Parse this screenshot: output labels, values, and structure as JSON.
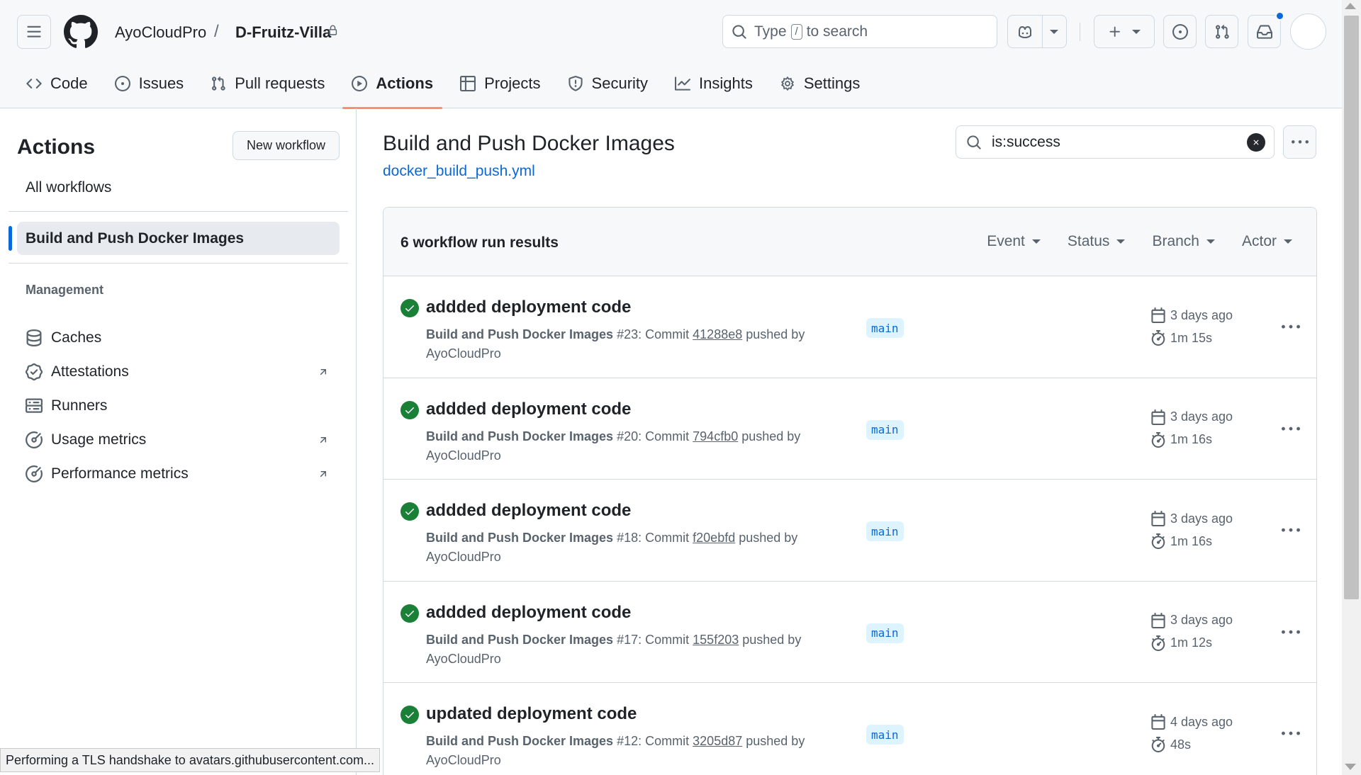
{
  "header": {
    "owner": "AyoCloudPro",
    "separator": "/",
    "repo": "D-Fruitz-Villa",
    "search_prefix": "Type",
    "search_key": "/",
    "search_suffix": "to search"
  },
  "repo_nav": [
    {
      "label": "Code",
      "icon": "code-icon",
      "active": false
    },
    {
      "label": "Issues",
      "icon": "issue-opened-icon",
      "active": false
    },
    {
      "label": "Pull requests",
      "icon": "git-pull-request-icon",
      "active": false
    },
    {
      "label": "Actions",
      "icon": "play-icon",
      "active": true
    },
    {
      "label": "Projects",
      "icon": "table-icon",
      "active": false
    },
    {
      "label": "Security",
      "icon": "shield-icon",
      "active": false
    },
    {
      "label": "Insights",
      "icon": "graph-icon",
      "active": false
    },
    {
      "label": "Settings",
      "icon": "gear-icon",
      "active": false
    }
  ],
  "sidebar": {
    "title": "Actions",
    "new_workflow": "New workflow",
    "all_workflows": "All workflows",
    "selected_workflow": "Build and Push Docker Images",
    "management_heading": "Management",
    "management_items": [
      {
        "label": "Caches",
        "icon": "database-icon",
        "external": false
      },
      {
        "label": "Attestations",
        "icon": "verified-icon",
        "external": true
      },
      {
        "label": "Runners",
        "icon": "server-icon",
        "external": false
      },
      {
        "label": "Usage metrics",
        "icon": "meter-icon",
        "external": true
      },
      {
        "label": "Performance metrics",
        "icon": "meter-icon",
        "external": true
      }
    ]
  },
  "main": {
    "workflow_title": "Build and Push Docker Images",
    "workflow_file": "docker_build_push.yml",
    "filter_value": "is:success",
    "results_count": "6 workflow run results",
    "facets": [
      "Event",
      "Status",
      "Branch",
      "Actor"
    ]
  },
  "runs": [
    {
      "title": "addded deployment code",
      "workflow": "Build and Push Docker Images",
      "number": "#23",
      "commit_prefix": ": Commit",
      "sha": "41288e8",
      "pushed_by": "pushed by",
      "actor": "AyoCloudPro",
      "branch": "main",
      "when": "3 days ago",
      "duration": "1m 15s",
      "status": "success"
    },
    {
      "title": "addded deployment code",
      "workflow": "Build and Push Docker Images",
      "number": "#20",
      "commit_prefix": ": Commit",
      "sha": "794cfb0",
      "pushed_by": "pushed by",
      "actor": "AyoCloudPro",
      "branch": "main",
      "when": "3 days ago",
      "duration": "1m 16s",
      "status": "success"
    },
    {
      "title": "addded deployment code",
      "workflow": "Build and Push Docker Images",
      "number": "#18",
      "commit_prefix": ": Commit",
      "sha": "f20ebfd",
      "pushed_by": "pushed by",
      "actor": "AyoCloudPro",
      "branch": "main",
      "when": "3 days ago",
      "duration": "1m 16s",
      "status": "success"
    },
    {
      "title": "addded deployment code",
      "workflow": "Build and Push Docker Images",
      "number": "#17",
      "commit_prefix": ": Commit",
      "sha": "155f203",
      "pushed_by": "pushed by",
      "actor": "AyoCloudPro",
      "branch": "main",
      "when": "3 days ago",
      "duration": "1m 12s",
      "status": "success"
    },
    {
      "title": "updated deployment code",
      "workflow": "Build and Push Docker Images",
      "number": "#12",
      "commit_prefix": ": Commit",
      "sha": "3205d87",
      "pushed_by": "pushed by",
      "actor": "AyoCloudPro",
      "branch": "main",
      "when": "4 days ago",
      "duration": "48s",
      "status": "success"
    }
  ],
  "status_bar": "Performing a TLS handshake to avatars.githubusercontent.com...",
  "colors": {
    "accent": "#0969da",
    "success": "#1a7f37",
    "active_tab_underline": "#fd8c73"
  }
}
